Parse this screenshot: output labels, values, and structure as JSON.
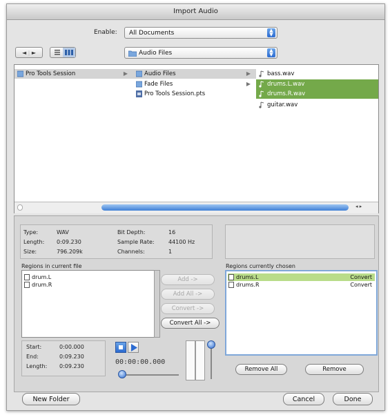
{
  "window": {
    "title": "Import Audio"
  },
  "enable": {
    "label": "Enable:",
    "value": "All Documents"
  },
  "nav": {
    "back": "◄",
    "forward": "►",
    "location": "Audio Files"
  },
  "browser": {
    "col1": [
      {
        "label": "Pro Tools Session"
      }
    ],
    "col2": [
      {
        "label": "Audio Files"
      },
      {
        "label": "Fade Files"
      },
      {
        "label": "Pro Tools Session.pts"
      }
    ],
    "col3": [
      {
        "label": "bass.wav"
      },
      {
        "label": "drums.L.wav"
      },
      {
        "label": "drums.R.wav"
      },
      {
        "label": "guitar.wav"
      }
    ]
  },
  "info": {
    "type_label": "Type:",
    "type_value": "WAV",
    "length_label": "Length:",
    "length_value": "0:09.230",
    "size_label": "Size:",
    "size_value": "796.209k",
    "bitdepth_label": "Bit Depth:",
    "bitdepth_value": "16",
    "samplerate_label": "Sample Rate:",
    "samplerate_value": "44100 Hz",
    "channels_label": "Channels:",
    "channels_value": "1"
  },
  "regions_current": {
    "label": "Regions in current file",
    "items": [
      "drum.L",
      "drum.R"
    ]
  },
  "regions_chosen": {
    "label": "Regions currently chosen",
    "items": [
      {
        "name": "drums.L",
        "action": "Convert"
      },
      {
        "name": "drums.R",
        "action": "Convert"
      }
    ]
  },
  "buttons": {
    "add": "Add ->",
    "add_all": "Add All ->",
    "convert": "Convert ->",
    "convert_all": "Convert All ->",
    "remove_all": "Remove All",
    "remove": "Remove",
    "new_folder": "New Folder",
    "cancel": "Cancel",
    "done": "Done"
  },
  "preview": {
    "start_label": "Start:",
    "start_value": "0:00.000",
    "end_label": "End:",
    "end_value": "0:09.230",
    "length_label": "Length:",
    "length_value": "0:09.230",
    "timecode": "00:00:00.000"
  },
  "colors": {
    "selection_green": "#74a94a",
    "chosen_green": "#b9dc8a",
    "accent_blue": "#2c6bd1"
  }
}
